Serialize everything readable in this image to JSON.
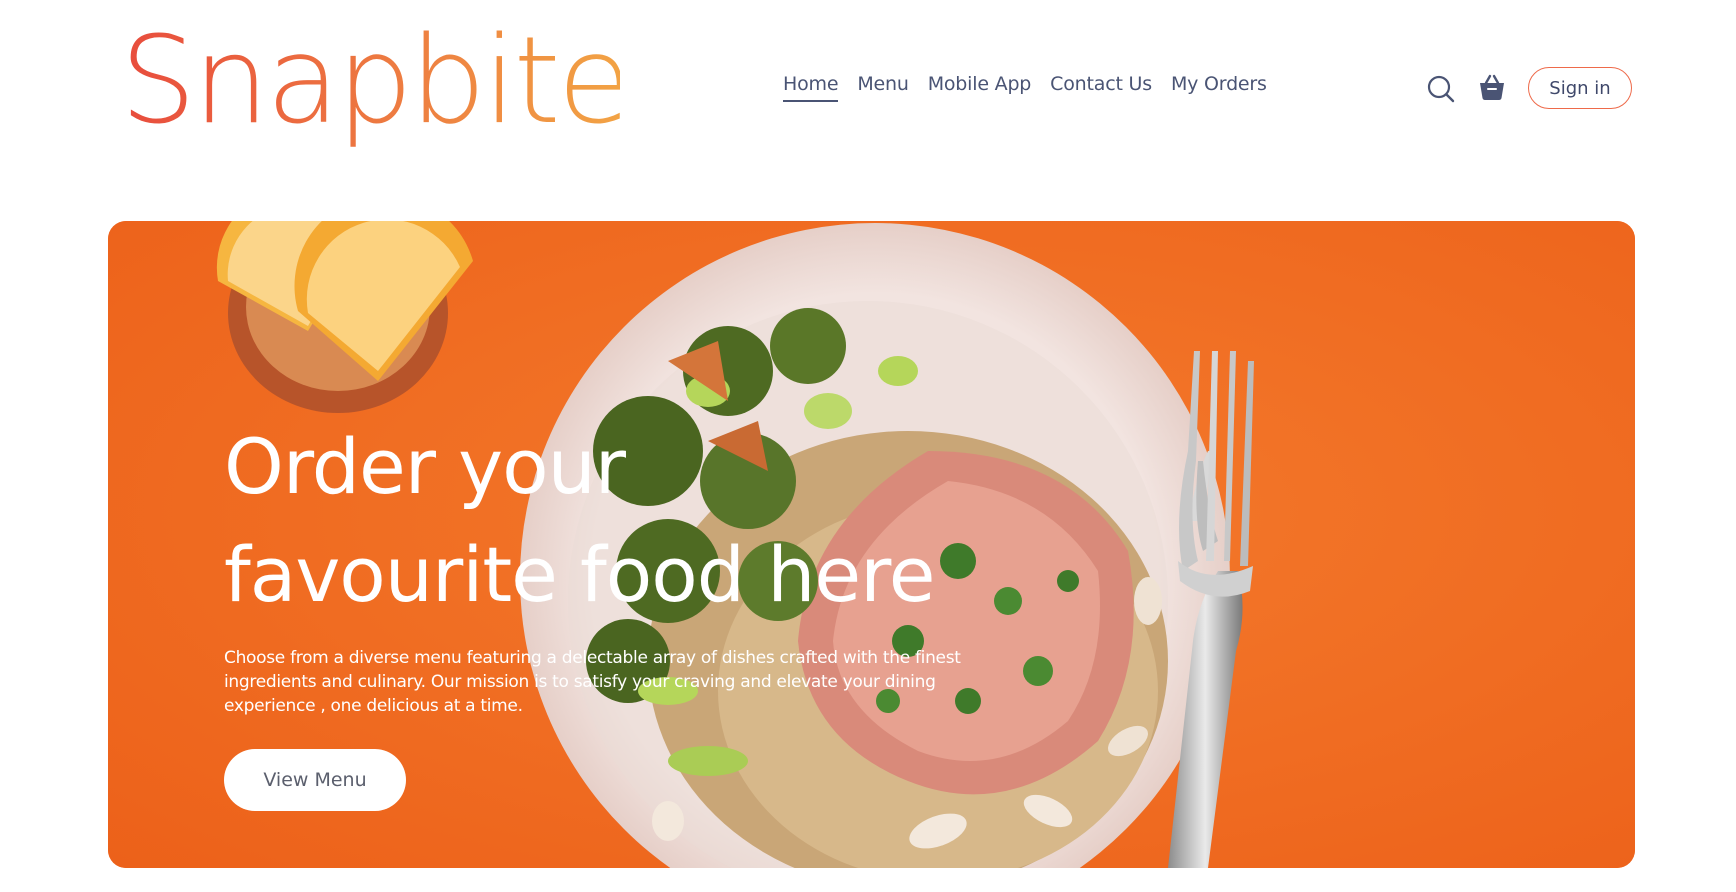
{
  "brand": {
    "name": "Snapbite",
    "gradient_start": "#e84c3d",
    "gradient_end": "#f2a444"
  },
  "nav": {
    "items": [
      {
        "label": "Home",
        "active": true
      },
      {
        "label": "Menu",
        "active": false
      },
      {
        "label": "Mobile App",
        "active": false
      },
      {
        "label": "Contact Us",
        "active": false
      },
      {
        "label": "My Orders",
        "active": false
      }
    ]
  },
  "header_icons": {
    "search": "search-icon",
    "basket": "basket-icon"
  },
  "auth": {
    "signin_label": "Sign in"
  },
  "hero": {
    "title_line1": "Order your",
    "title_line2": "favourite food here",
    "description": "Choose from a diverse menu featuring a delectable array of dishes crafted with the finest ingredients and culinary. Our mission is to satisfy your craving and elevate your dining experience , one delicious at a time.",
    "cta_label": "View Menu",
    "background_color": "#f26b23"
  },
  "colors": {
    "nav_text": "#4a5474",
    "accent_border": "#ee6a4a",
    "hero_orange": "#f26b23"
  }
}
